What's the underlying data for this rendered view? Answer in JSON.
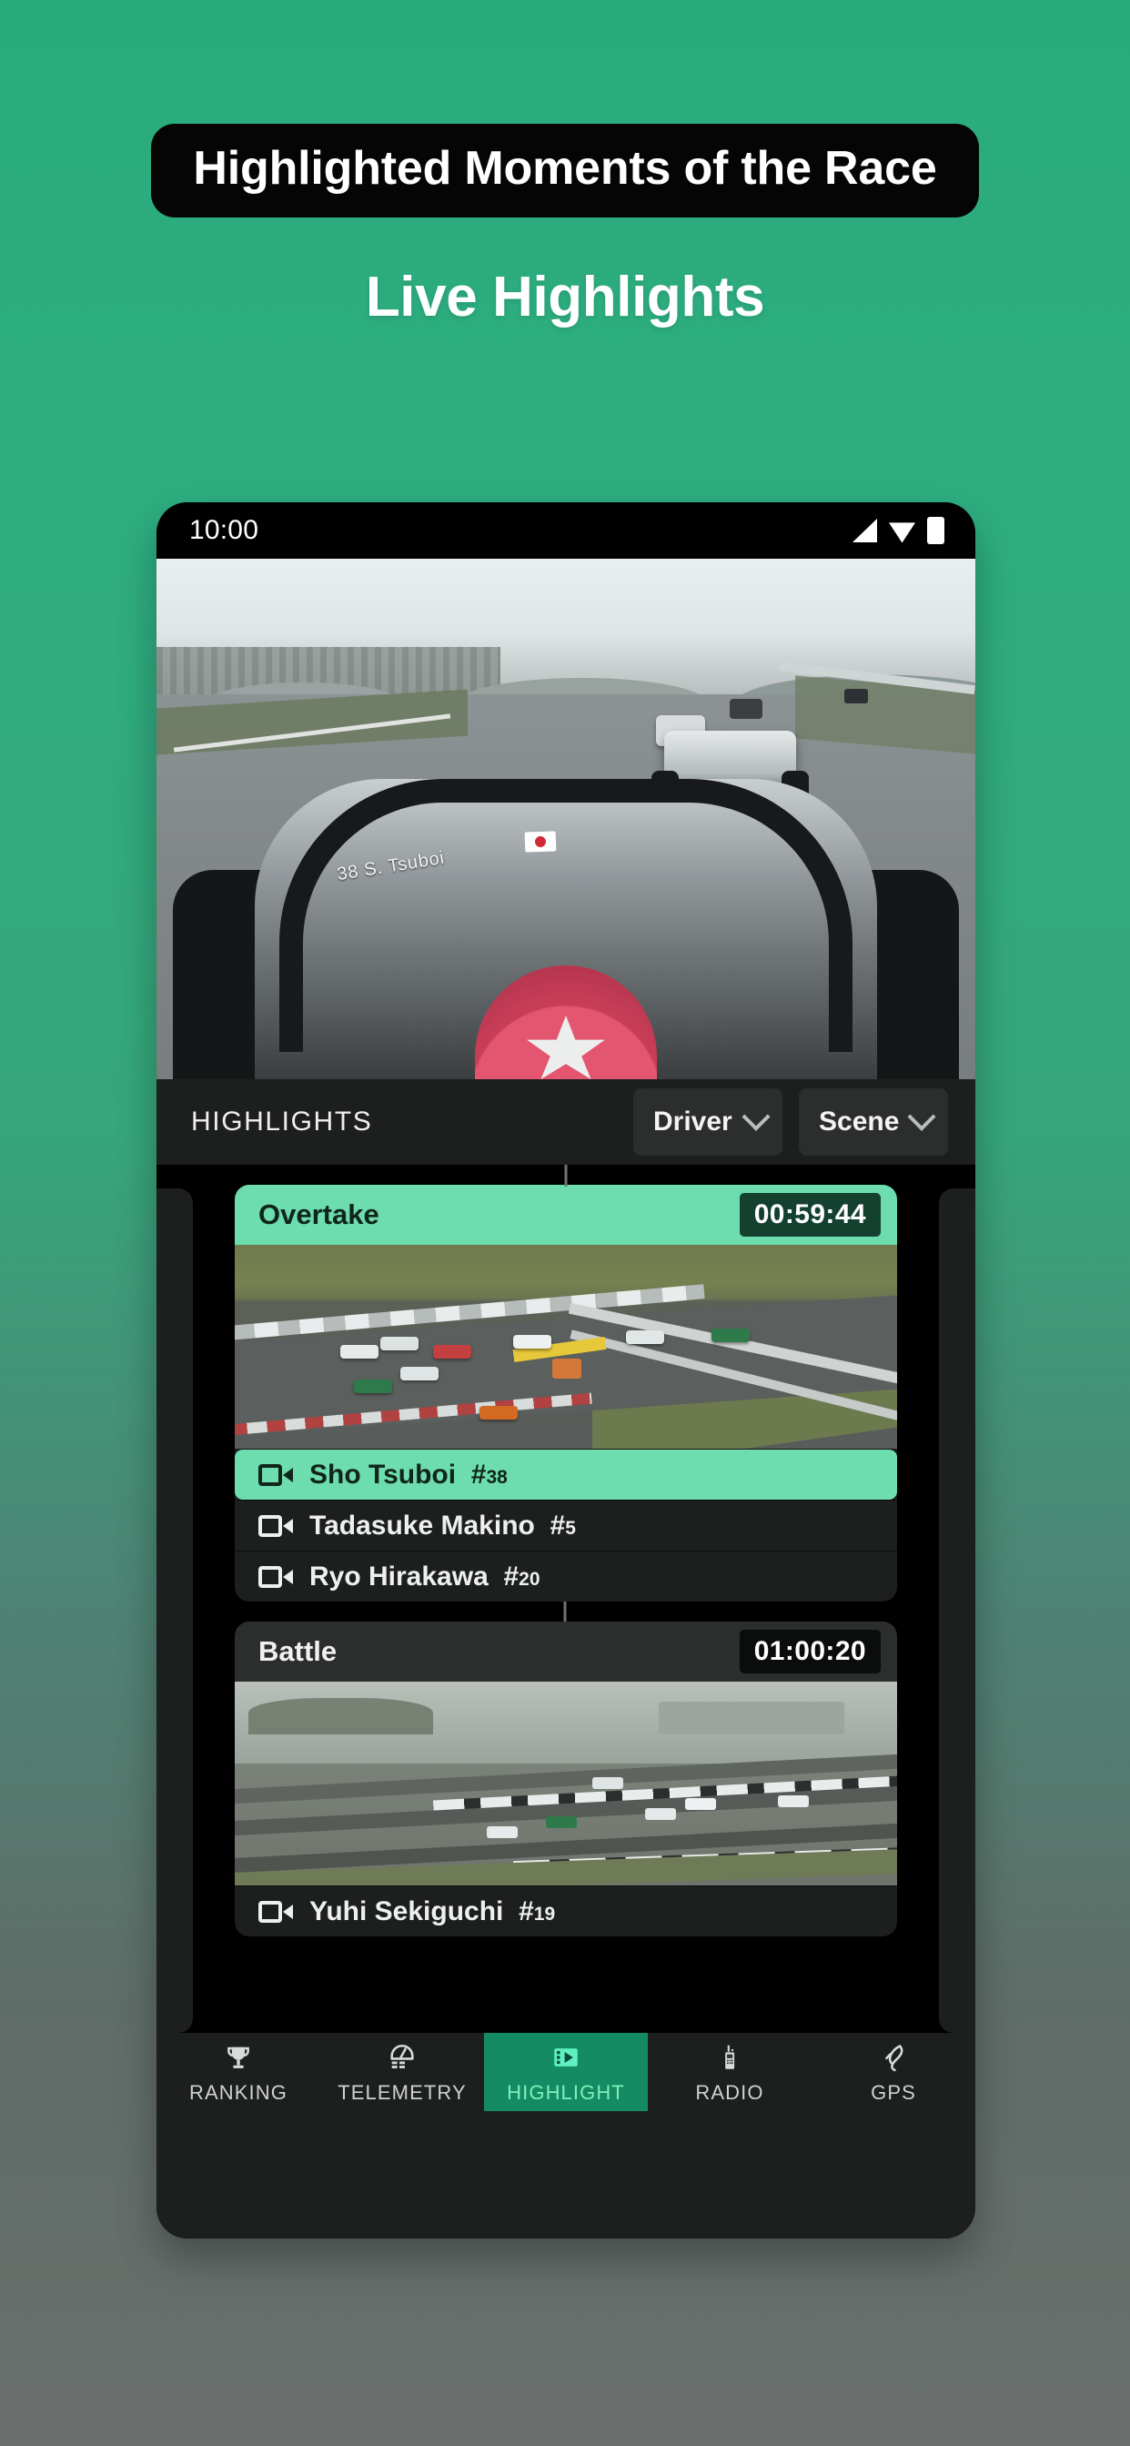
{
  "promo": {
    "badge_text": "Highlighted Moments of the Race",
    "subtitle": "Live Highlights",
    "accent_color": "#2aab7c",
    "badge_bg": "#050505"
  },
  "phone": {
    "status_bar": {
      "time": "10:00",
      "icons": [
        "signal-icon",
        "wifi-icon",
        "battery-icon"
      ]
    },
    "hero": {
      "overlay_text": "38  S. Tsuboi",
      "description": "onboard camera view"
    },
    "control_bar": {
      "title": "HIGHLIGHTS",
      "filters": [
        {
          "name": "driver-filter",
          "label": "Driver",
          "chevron": "chevron-down-icon"
        },
        {
          "name": "scene-filter",
          "label": "Scene",
          "chevron": "chevron-down-icon"
        }
      ]
    },
    "cards": [
      {
        "title": "Overtake",
        "timestamp": "00:59:44",
        "accent": true,
        "drivers": [
          {
            "name": "Sho Tsuboi",
            "number": "38",
            "selected": true
          },
          {
            "name": "Tadasuke Makino",
            "number": "5",
            "selected": false
          },
          {
            "name": "Ryo Hirakawa",
            "number": "20",
            "selected": false
          }
        ]
      },
      {
        "title": "Battle",
        "timestamp": "01:00:20",
        "accent": false,
        "drivers": [
          {
            "name": "Yuhi Sekiguchi",
            "number": "19",
            "selected": false
          }
        ]
      }
    ],
    "nav": [
      {
        "label": "RANKING",
        "icon": "trophy-icon",
        "active": false
      },
      {
        "label": "TELEMETRY",
        "icon": "gauge-icon",
        "active": false
      },
      {
        "label": "HIGHLIGHT",
        "icon": "film-play-icon",
        "active": true
      },
      {
        "label": "RADIO",
        "icon": "radio-icon",
        "active": false
      },
      {
        "label": "GPS",
        "icon": "track-map-icon",
        "active": false
      }
    ]
  },
  "colors": {
    "accent_green": "#6ddcae",
    "nav_active": "#148b63",
    "panel_dark": "#1d1e1e",
    "panel_mid": "#2c2d2d"
  }
}
